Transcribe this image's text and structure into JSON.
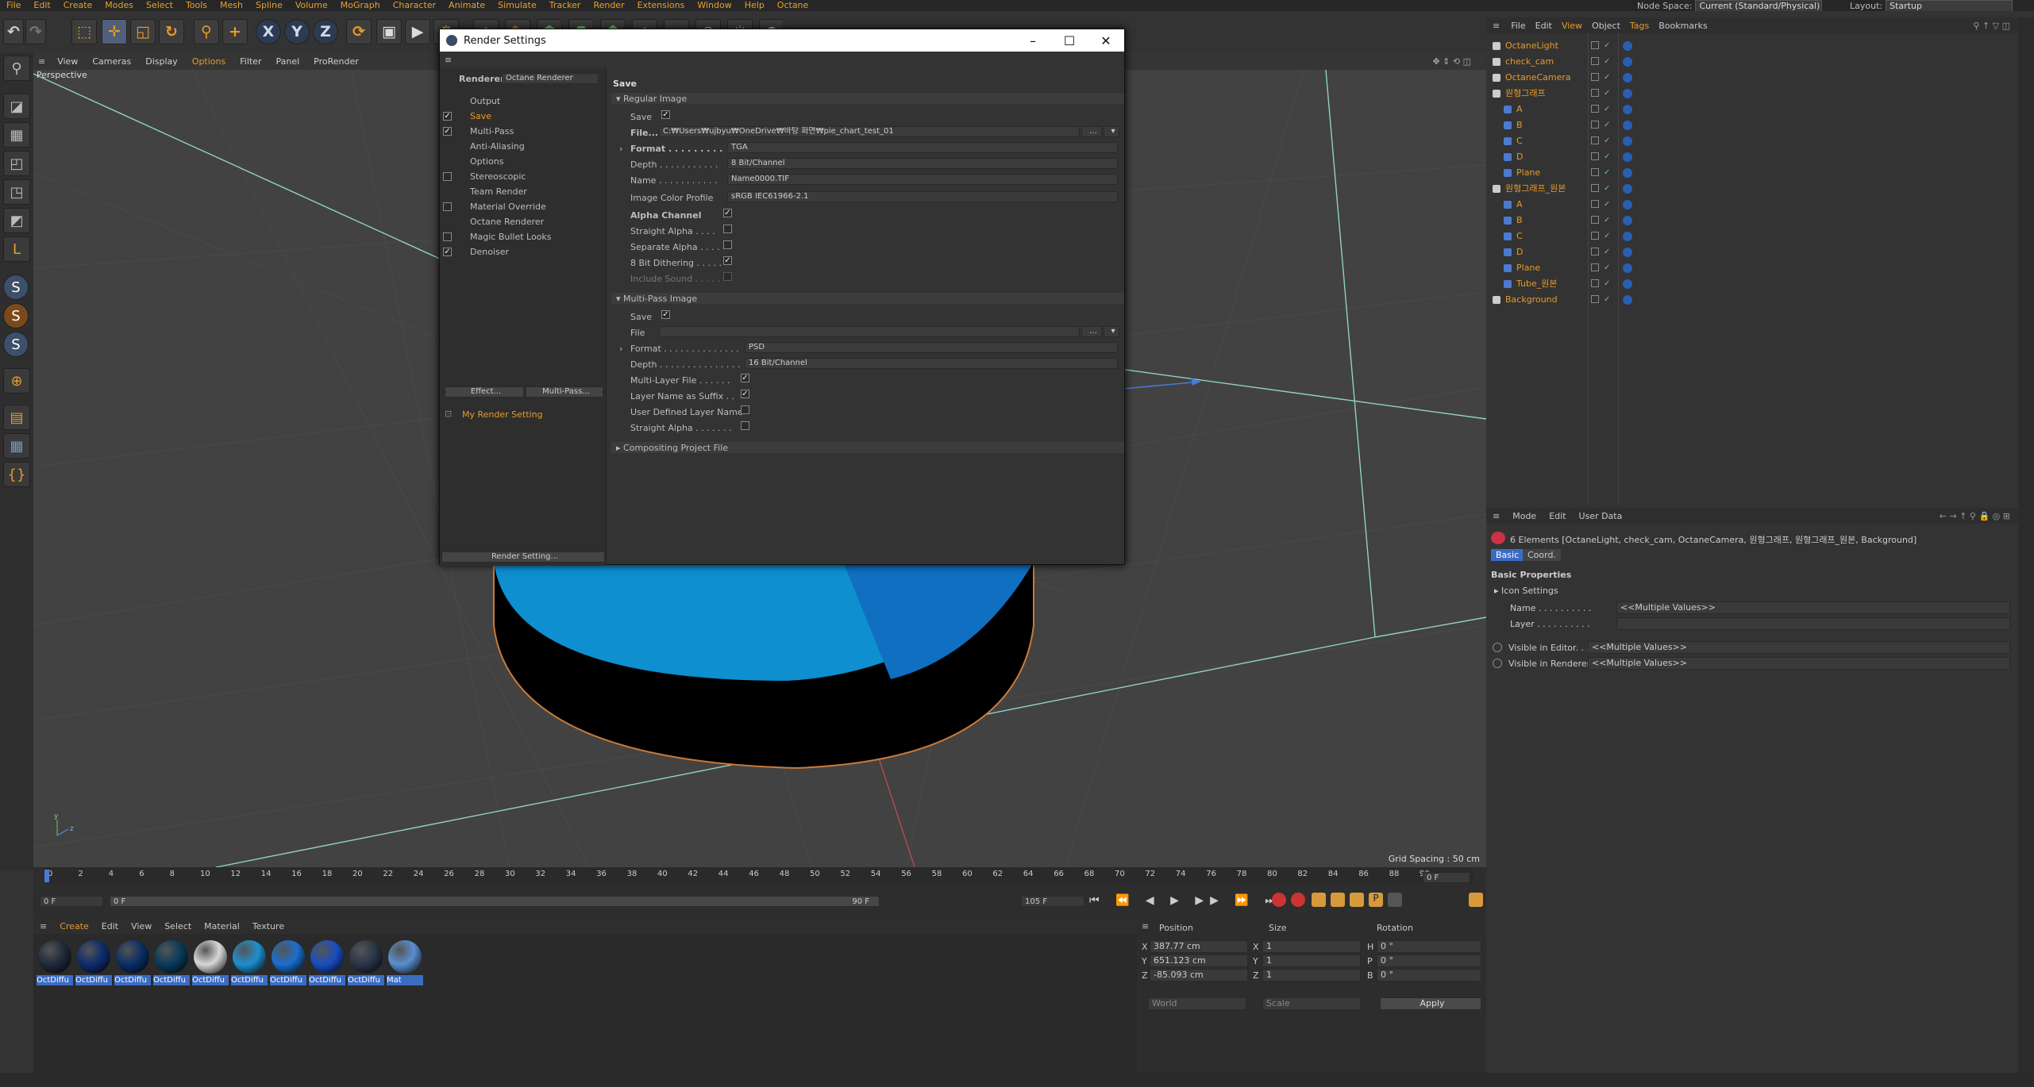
{
  "menubar": {
    "items": [
      "File",
      "Edit",
      "Create",
      "Modes",
      "Select",
      "Tools",
      "Mesh",
      "Spline",
      "Volume",
      "MoGraph",
      "Character",
      "Animate",
      "Simulate",
      "Tracker",
      "Render",
      "Extensions",
      "Window",
      "Help",
      "Octane"
    ],
    "node_space_label": "Node Space:",
    "node_space_value": "Current (Standard/Physical)",
    "layout_label": "Layout:",
    "layout_value": "Startup"
  },
  "viewport": {
    "menu": [
      "View",
      "Cameras",
      "Display",
      "Options",
      "Filter",
      "Panel",
      "ProRender"
    ],
    "label": "Perspective",
    "grid_spacing": "Grid Spacing : 50 cm"
  },
  "timeline": {
    "ticks": [
      "0",
      "2",
      "4",
      "6",
      "8",
      "10",
      "12",
      "14",
      "16",
      "18",
      "20",
      "22",
      "24",
      "26",
      "28",
      "30",
      "32",
      "34",
      "36",
      "38",
      "40",
      "42",
      "44",
      "46",
      "48",
      "50",
      "52",
      "54",
      "56",
      "58",
      "60",
      "62",
      "64",
      "66",
      "68",
      "70",
      "72",
      "74",
      "76",
      "78",
      "80",
      "82",
      "84",
      "86",
      "88",
      "90"
    ],
    "current_frame": "0 F",
    "start": "0 F",
    "range_start": "0 F",
    "range_end": "90 F",
    "end": "105 F",
    "right_frame": "0 F"
  },
  "materials": {
    "menu": [
      "Create",
      "Edit",
      "View",
      "Select",
      "Material",
      "Texture"
    ],
    "items": [
      {
        "label": "OctDiffu",
        "color": "#1f2a3a"
      },
      {
        "label": "OctDiffu",
        "color": "#0e2c6e"
      },
      {
        "label": "OctDiffu",
        "color": "#0a2f66"
      },
      {
        "label": "OctDiffu",
        "color": "#0a3b5a"
      },
      {
        "label": "OctDiffu",
        "color": "#d8d8d8"
      },
      {
        "label": "OctDiffu",
        "color": "#1f8fd0"
      },
      {
        "label": "OctDiffu",
        "color": "#1a6fcf"
      },
      {
        "label": "OctDiffu",
        "color": "#1a4ec0"
      },
      {
        "label": "OctDiffu",
        "color": "#2a3548"
      },
      {
        "label": "Mat",
        "color": "#5a8fd0"
      }
    ]
  },
  "coords": {
    "headers": [
      "Position",
      "Size",
      "Rotation"
    ],
    "rows": [
      {
        "axis": "X",
        "pos": "387.77 cm",
        "saxis": "X",
        "size": "1",
        "raxis": "H",
        "rot": "0 °"
      },
      {
        "axis": "Y",
        "pos": "651.123 cm",
        "saxis": "Y",
        "size": "1",
        "raxis": "P",
        "rot": "0 °"
      },
      {
        "axis": "Z",
        "pos": "-85.093 cm",
        "saxis": "Z",
        "size": "1",
        "raxis": "B",
        "rot": "0 °"
      }
    ],
    "world": "World",
    "scale": "Scale",
    "apply": "Apply"
  },
  "objects": {
    "menu": [
      "File",
      "Edit",
      "View",
      "Object",
      "Tags",
      "Bookmarks"
    ],
    "rows": [
      {
        "name": "OctaneLight",
        "indent": 0,
        "color": "orange"
      },
      {
        "name": "check_cam",
        "indent": 0,
        "color": "orange"
      },
      {
        "name": "OctaneCamera",
        "indent": 0,
        "color": "orange"
      },
      {
        "name": "원형그래프",
        "indent": 0,
        "color": "orange"
      },
      {
        "name": "A",
        "indent": 1,
        "color": "orange"
      },
      {
        "name": "B",
        "indent": 1,
        "color": "orange"
      },
      {
        "name": "C",
        "indent": 1,
        "color": "orange"
      },
      {
        "name": "D",
        "indent": 1,
        "color": "orange"
      },
      {
        "name": "Plane",
        "indent": 1,
        "color": "orange"
      },
      {
        "name": "원형그래프_원본",
        "indent": 0,
        "color": "orange"
      },
      {
        "name": "A",
        "indent": 1,
        "color": "orange"
      },
      {
        "name": "B",
        "indent": 1,
        "color": "orange"
      },
      {
        "name": "C",
        "indent": 1,
        "color": "orange"
      },
      {
        "name": "D",
        "indent": 1,
        "color": "orange"
      },
      {
        "name": "Plane",
        "indent": 1,
        "color": "orange"
      },
      {
        "name": "Tube_원본",
        "indent": 1,
        "color": "orange"
      },
      {
        "name": "Background",
        "indent": 0,
        "color": "orange"
      }
    ]
  },
  "attributes": {
    "menu": [
      "Mode",
      "Edit",
      "User Data"
    ],
    "summary": "6 Elements [OctaneLight, check_cam, OctaneCamera, 원형그래프, 원형그래프_원본, Background]",
    "tabs": [
      "Basic",
      "Coord."
    ],
    "section": "Basic Properties",
    "icon_settings": "Icon Settings",
    "name_label": "Name . . . . . . . . . .",
    "name_value": "<<Multiple Values>>",
    "layer_label": "Layer . . . . . . . . . .",
    "vis_editor_label": "Visible in Editor. . .",
    "vis_editor_value": "<<Multiple Values>>",
    "vis_render_label": "Visible in Renderer",
    "vis_render_value": "<<Multiple Values>>"
  },
  "render_settings": {
    "title": "Render Settings",
    "renderer_label": "Renderer",
    "renderer_value": "Octane Renderer",
    "nav": [
      {
        "label": "Output",
        "checkbox": false,
        "checked": false,
        "active": false
      },
      {
        "label": "Save",
        "checkbox": true,
        "checked": true,
        "active": true
      },
      {
        "label": "Multi-Pass",
        "checkbox": true,
        "checked": true,
        "active": false
      },
      {
        "label": "Anti-Aliasing",
        "checkbox": false,
        "checked": false,
        "active": false
      },
      {
        "label": "Options",
        "checkbox": false,
        "checked": false,
        "active": false
      },
      {
        "label": "Stereoscopic",
        "checkbox": true,
        "checked": false,
        "active": false
      },
      {
        "label": "Team Render",
        "checkbox": false,
        "checked": false,
        "active": false
      },
      {
        "label": "Material Override",
        "checkbox": true,
        "checked": false,
        "active": false
      },
      {
        "label": "Octane Renderer",
        "checkbox": false,
        "checked": false,
        "active": false
      },
      {
        "label": "Magic Bullet Looks",
        "checkbox": true,
        "checked": false,
        "active": false
      },
      {
        "label": "Denoiser",
        "checkbox": true,
        "checked": true,
        "active": false
      }
    ],
    "effect_btn": "Effect...",
    "multipass_btn": "Multi-Pass...",
    "preset": "My Render Setting",
    "render_setting_btn": "Render Setting...",
    "section": "Save",
    "regular_image": "Regular Image",
    "save_label": "Save",
    "file_label": "File...",
    "file_path": "C:₩Users₩ujbyu₩OneDrive₩바탕 화면₩pie_chart_test_01",
    "format_label": "Format",
    "format_value": "TGA",
    "depth_label": "Depth",
    "depth_value": "8 Bit/Channel",
    "name_label": "Name",
    "name_value": "Name0000.TIF",
    "profile_label": "Image Color Profile",
    "profile_value": "sRGB IEC61966-2.1",
    "alpha_label": "Alpha Channel",
    "straight_alpha": "Straight Alpha",
    "separate_alpha": "Separate Alpha",
    "dithering": "8 Bit Dithering",
    "include_sound": "Include Sound",
    "multipass_image": "Multi-Pass Image",
    "mp_save": "Save",
    "mp_file": "File",
    "mp_format_label": "Format",
    "mp_format_value": "PSD",
    "mp_depth_label": "Depth",
    "mp_depth_value": "16 Bit/Channel",
    "mp_layer_file": "Multi-Layer File",
    "mp_layer_suffix": "Layer Name as Suffix",
    "mp_user_layer": "User Defined Layer Name",
    "mp_straight": "Straight Alpha",
    "compositing": "Compositing Project File"
  }
}
